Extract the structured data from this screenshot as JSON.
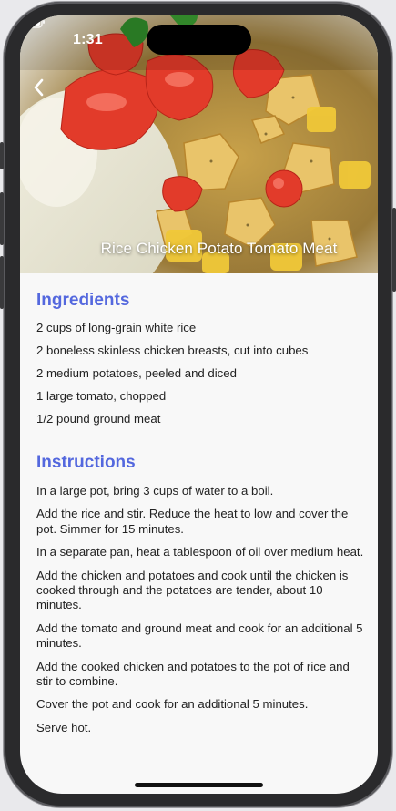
{
  "status_bar": {
    "time": "1:31"
  },
  "recipe": {
    "title": "Rice Chicken Potato Tomato Meat"
  },
  "sections": {
    "ingredients_heading": "Ingredients",
    "instructions_heading": "Instructions"
  },
  "ingredients": [
    "2 cups of long-grain white rice",
    "2 boneless skinless chicken breasts, cut into cubes",
    "2 medium potatoes, peeled and diced",
    "1 large tomato, chopped",
    "1/2 pound ground meat"
  ],
  "instructions": [
    "In a large pot, bring 3 cups of water to a boil.",
    "Add the rice and stir. Reduce the heat to low and cover the pot. Simmer for 15 minutes.",
    "In a separate pan, heat a tablespoon of oil over medium heat.",
    "Add the chicken and potatoes and cook until the chicken is cooked through and the potatoes are tender, about 10 minutes.",
    "Add the tomato and ground meat and cook for an additional 5 minutes.",
    "Add the cooked chicken and potatoes to the pot of rice and stir to combine.",
    "Cover the pot and cook for an additional 5 minutes.",
    "Serve hot."
  ],
  "colors": {
    "heading_accent": "#5468de",
    "background": "#f8f8f8"
  },
  "icons": {
    "back": "chevron-left-icon",
    "signal": "signal-dots-icon",
    "wifi": "wifi-icon",
    "battery": "battery-icon"
  }
}
